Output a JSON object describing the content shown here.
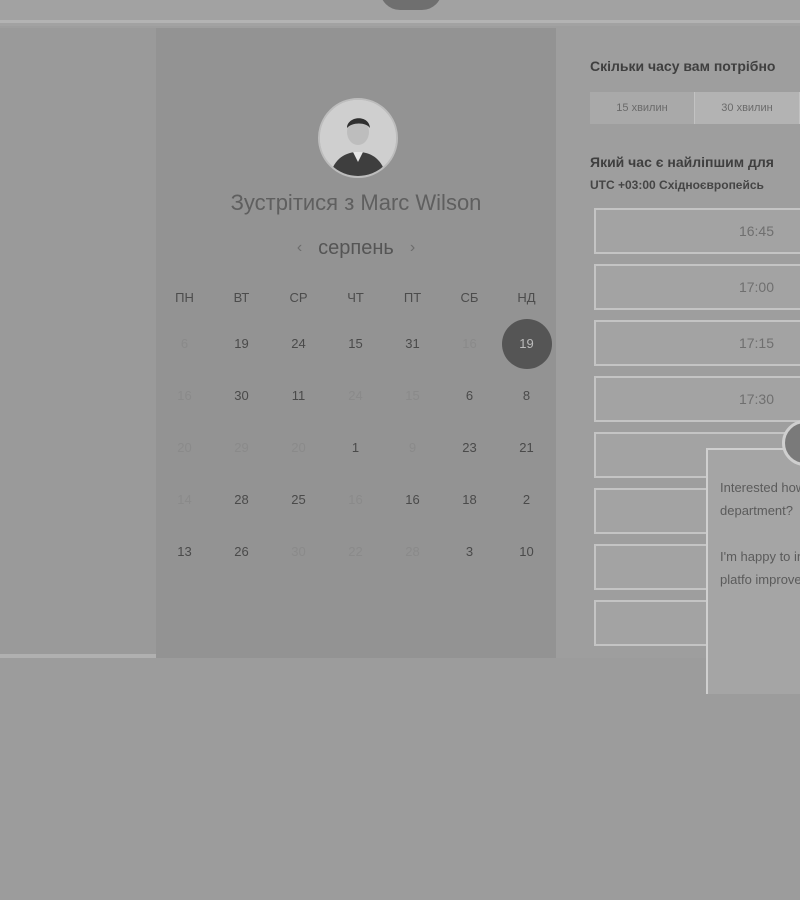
{
  "header": {
    "logo_icon": "brand-logo-icon"
  },
  "calendar": {
    "title": "Зустрітися з Marc Wilson",
    "month": "серпень",
    "prev_icon": "chevron-left-icon",
    "next_icon": "chevron-right-icon",
    "weekdays": [
      "ПН",
      "ВТ",
      "СР",
      "ЧТ",
      "ПТ",
      "СБ",
      "НД"
    ],
    "weeks": [
      [
        {
          "d": "6",
          "f": true
        },
        {
          "d": "19",
          "f": false
        },
        {
          "d": "24",
          "f": false
        },
        {
          "d": "15",
          "f": false
        },
        {
          "d": "31",
          "f": false
        },
        {
          "d": "16",
          "f": true
        },
        {
          "d": "19",
          "f": false,
          "sel": true
        }
      ],
      [
        {
          "d": "16",
          "f": true
        },
        {
          "d": "30",
          "f": false
        },
        {
          "d": "11",
          "f": false
        },
        {
          "d": "24",
          "f": true
        },
        {
          "d": "15",
          "f": true
        },
        {
          "d": "6",
          "f": false
        },
        {
          "d": "8",
          "f": false
        }
      ],
      [
        {
          "d": "20",
          "f": true
        },
        {
          "d": "29",
          "f": true
        },
        {
          "d": "20",
          "f": true
        },
        {
          "d": "1",
          "f": false
        },
        {
          "d": "9",
          "f": true
        },
        {
          "d": "23",
          "f": false
        },
        {
          "d": "21",
          "f": false
        }
      ],
      [
        {
          "d": "14",
          "f": true
        },
        {
          "d": "28",
          "f": false
        },
        {
          "d": "25",
          "f": false
        },
        {
          "d": "16",
          "f": true
        },
        {
          "d": "16",
          "f": false
        },
        {
          "d": "18",
          "f": false
        },
        {
          "d": "2",
          "f": false
        }
      ],
      [
        {
          "d": "13",
          "f": false
        },
        {
          "d": "26",
          "f": false
        },
        {
          "d": "30",
          "f": true
        },
        {
          "d": "22",
          "f": true
        },
        {
          "d": "28",
          "f": true
        },
        {
          "d": "3",
          "f": false
        },
        {
          "d": "10",
          "f": false
        }
      ]
    ]
  },
  "booking": {
    "duration_question": "Скільки часу вам потрібно",
    "durations": [
      "15 хвилин",
      "30 хвилин"
    ],
    "time_question": "Який час є найліпшим для",
    "timezone": "UTC +03:00 Східноєвропейсь",
    "slots": [
      "16:45",
      "17:00",
      "17:15",
      "17:30",
      "",
      "",
      "",
      ""
    ]
  },
  "chat": {
    "paragraph1": "Interested how Management department?",
    "paragraph2": "I'm happy to insight into h use our platfo improvement productivity."
  }
}
